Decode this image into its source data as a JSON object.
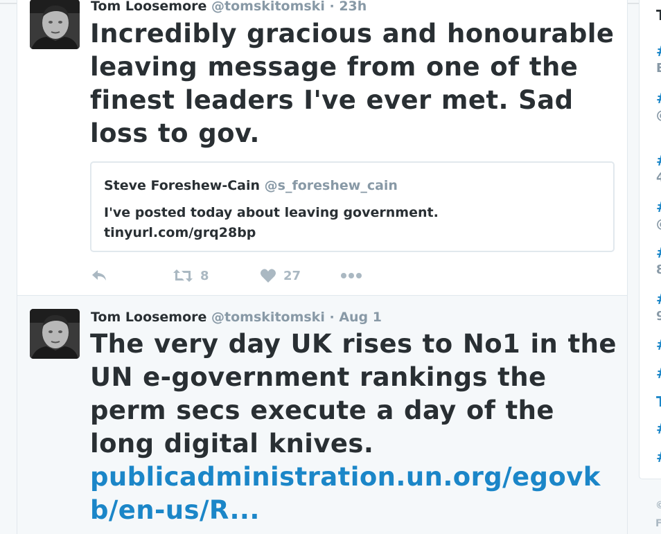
{
  "tweets": [
    {
      "author": "Tom Loosemore",
      "handle": "@tomskitomski",
      "separator": "·",
      "time": "23h",
      "text": "Incredibly gracious and honourable leaving message from one of the finest leaders I've ever met. Sad loss to gov.",
      "quote": {
        "author": "Steve Foreshew-Cain",
        "handle": "@s_foreshew_cain",
        "text": "I've posted today about leaving government. tinyurl.com/grq28bp"
      },
      "actions": {
        "retweets": "8",
        "likes": "27"
      }
    },
    {
      "author": "Tom Loosemore",
      "handle": "@tomskitomski",
      "separator": "·",
      "time": "Aug 1",
      "text": "The very day UK rises to No1 in the UN e-government rankings the perm secs execute a day of the long digital knives.",
      "link": "publicadministration.un.org/egovkb/en-us/R..."
    }
  ],
  "sidebar": {
    "top_glyph": "T",
    "items": [
      {
        "glyph": "#",
        "sub": "E"
      },
      {
        "glyph": "#",
        "sub": "@"
      },
      {
        "glyph": "#",
        "sub": "4"
      },
      {
        "glyph": "#",
        "sub": "@"
      },
      {
        "glyph": "#",
        "sub": "8"
      },
      {
        "glyph": "#",
        "sub": "9"
      },
      {
        "glyph": "#",
        "sub": ""
      },
      {
        "glyph": "#",
        "sub": ""
      },
      {
        "glyph": "T",
        "sub": ""
      },
      {
        "glyph": "#",
        "sub": ""
      },
      {
        "glyph": "#",
        "sub": ""
      }
    ],
    "footer": [
      "©",
      "F"
    ]
  },
  "colors": {
    "link": "#1b86c8",
    "text": "#292f33",
    "muted": "#8899a6",
    "action": "#aab8c2"
  }
}
